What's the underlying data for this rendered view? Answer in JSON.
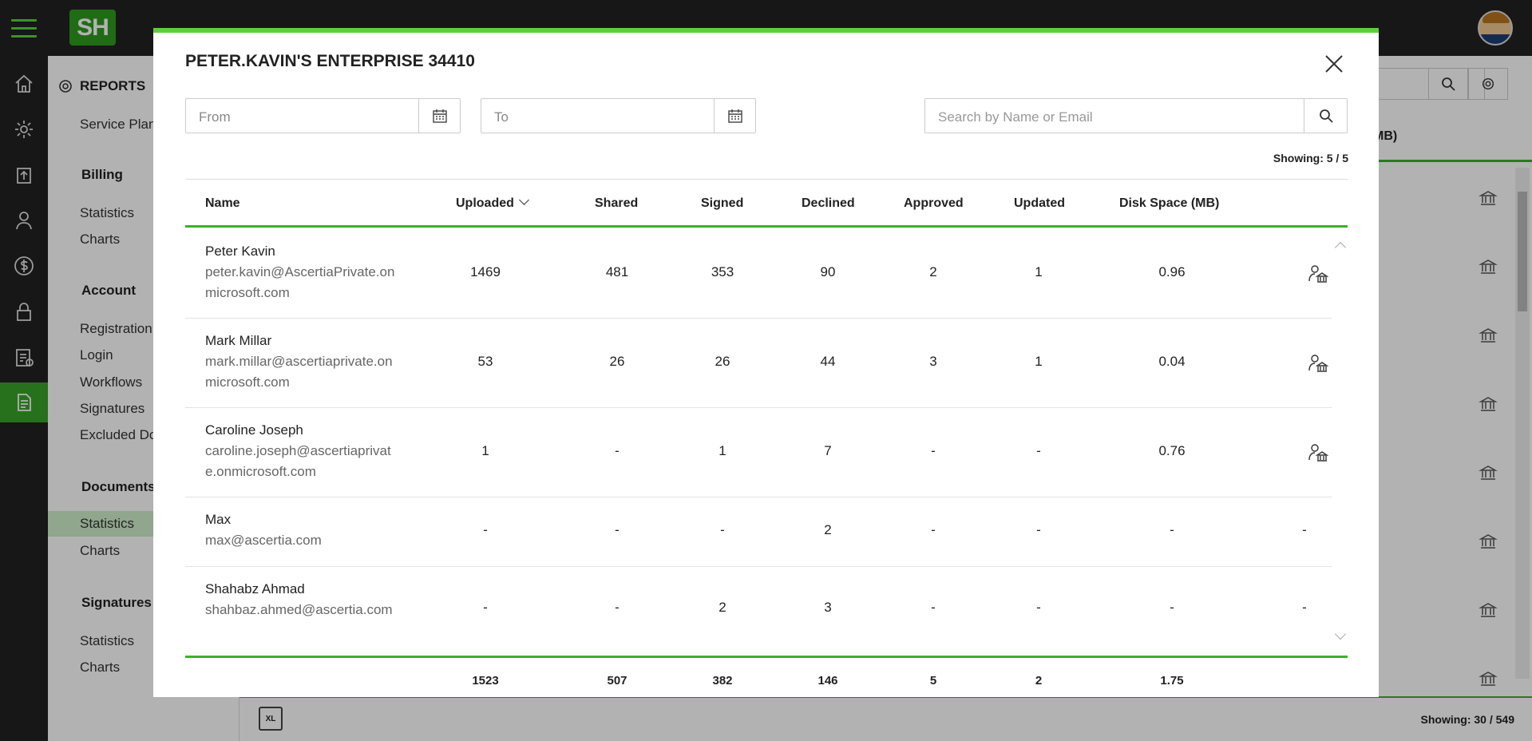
{
  "app": {
    "logo_text": "SH"
  },
  "rail_icons": [
    "home-icon",
    "gear-icon",
    "upload-icon",
    "user-icon",
    "dollar-icon",
    "lock-icon",
    "clipboard-icon",
    "document-icon"
  ],
  "sidebar": {
    "title": "REPORTS",
    "service_plan": "Service Plan",
    "billing": {
      "label": "Billing",
      "items": [
        "Statistics",
        "Charts"
      ]
    },
    "account": {
      "label": "Account",
      "items": [
        "Registration",
        "Login",
        "Workflows",
        "Signatures",
        "Excluded Do"
      ]
    },
    "documents": {
      "label": "Documents",
      "items": [
        "Statistics",
        "Charts"
      ]
    },
    "signatures": {
      "label": "Signatures",
      "items": [
        "Statistics",
        "Charts"
      ]
    }
  },
  "background": {
    "col_header_fragment": "MB)",
    "showing": "Showing: 30 / 549",
    "xl_label": "XL"
  },
  "modal": {
    "title": "PETER.KAVIN'S ENTERPRISE 34410",
    "from_placeholder": "From",
    "to_placeholder": "To",
    "search_placeholder": "Search by Name or Email",
    "showing": "Showing: 5 / 5",
    "columns": [
      "Name",
      "Uploaded",
      "Shared",
      "Signed",
      "Declined",
      "Approved",
      "Updated",
      "Disk Space (MB)"
    ],
    "rows": [
      {
        "name": "Peter Kavin",
        "email": "peter.kavin@AscertiaPrivate.onmicrosoft.com",
        "uploaded": "1469",
        "shared": "481",
        "signed": "353",
        "declined": "90",
        "approved": "2",
        "updated": "1",
        "disk": "0.96",
        "action": "icon"
      },
      {
        "name": "Mark Millar",
        "email": "mark.millar@ascertiaprivate.onmicrosoft.com",
        "uploaded": "53",
        "shared": "26",
        "signed": "26",
        "declined": "44",
        "approved": "3",
        "updated": "1",
        "disk": "0.04",
        "action": "icon"
      },
      {
        "name": "Caroline Joseph",
        "email": "caroline.joseph@ascertiaprivate.onmicrosoft.com",
        "uploaded": "1",
        "shared": "-",
        "signed": "1",
        "declined": "7",
        "approved": "-",
        "updated": "-",
        "disk": "0.76",
        "action": "icon"
      },
      {
        "name": "Max",
        "email": "max@ascertia.com",
        "uploaded": "-",
        "shared": "-",
        "signed": "-",
        "declined": "2",
        "approved": "-",
        "updated": "-",
        "disk": "-",
        "action": "-"
      },
      {
        "name": "Shahabz Ahmad",
        "email": "shahbaz.ahmed@ascertia.com",
        "uploaded": "-",
        "shared": "-",
        "signed": "2",
        "declined": "3",
        "approved": "-",
        "updated": "-",
        "disk": "-",
        "action": "-"
      }
    ],
    "totals": {
      "uploaded": "1523",
      "shared": "507",
      "signed": "382",
      "declined": "146",
      "approved": "5",
      "updated": "2",
      "disk": "1.75"
    }
  },
  "colors": {
    "accent": "#3bb12a",
    "topbar": "#222222",
    "active_side": "#cfeecb"
  }
}
